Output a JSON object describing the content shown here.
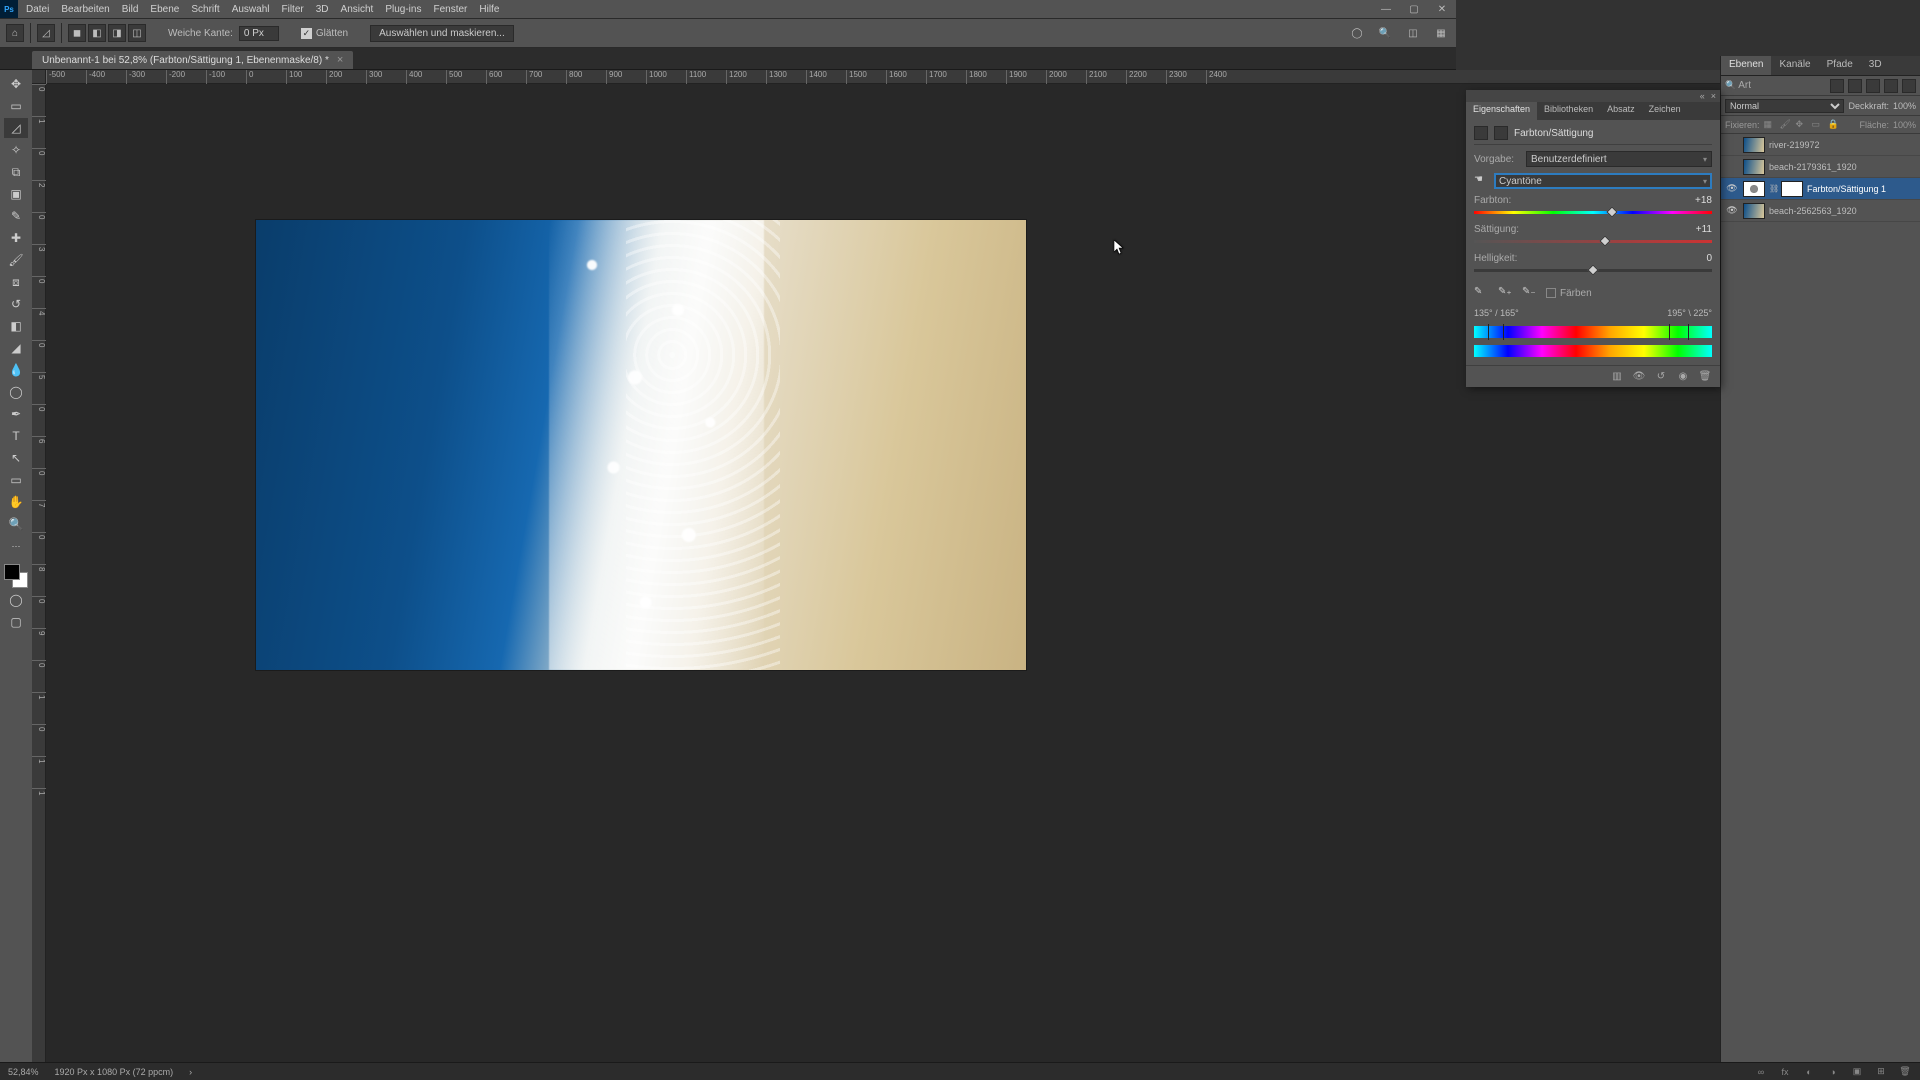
{
  "menu": [
    "Datei",
    "Bearbeiten",
    "Bild",
    "Ebene",
    "Schrift",
    "Auswahl",
    "Filter",
    "3D",
    "Ansicht",
    "Plug-ins",
    "Fenster",
    "Hilfe"
  ],
  "options": {
    "feather_label": "Weiche Kante:",
    "feather_value": "0 Px",
    "antialias_label": "Glätten",
    "select_mask_label": "Auswählen und maskieren..."
  },
  "doc_tab": {
    "title": "Unbenannt-1 bei 52,8% (Farbton/Sättigung 1, Ebenenmaske/8) *"
  },
  "ruler_h": [
    "-500",
    "-400",
    "-300",
    "-200",
    "-100",
    "0",
    "100",
    "200",
    "300",
    "400",
    "500",
    "600",
    "700",
    "800",
    "900",
    "1000",
    "1100",
    "1200",
    "1300",
    "1400",
    "1500",
    "1600",
    "1700",
    "1800",
    "1900",
    "2000",
    "2100",
    "2200",
    "2300",
    "2400"
  ],
  "ruler_v": [
    "0",
    "1",
    "0",
    "2",
    "0",
    "3",
    "0",
    "4",
    "0",
    "5",
    "0",
    "6",
    "0",
    "7",
    "0",
    "8",
    "0",
    "9",
    "0",
    "1",
    "0",
    "1",
    "1"
  ],
  "status": {
    "zoom": "52,84%",
    "dims": "1920 Px x 1080 Px (72 ppcm)"
  },
  "props": {
    "tabs": [
      "Eigenschaften",
      "Bibliotheken",
      "Absatz",
      "Zeichen"
    ],
    "title": "Farbton/Sättigung",
    "preset_label": "Vorgabe:",
    "preset_value": "Benutzerdefiniert",
    "range_value": "Cyantöne",
    "hue_label": "Farbton:",
    "hue_value": "+18",
    "sat_label": "Sättigung:",
    "sat_value": "+11",
    "light_label": "Helligkeit:",
    "light_value": "0",
    "colorize_label": "Färben",
    "range_left": "135° / 165°",
    "range_right": "195° \\ 225°"
  },
  "layers": {
    "tabs": [
      "Ebenen",
      "Kanäle",
      "Pfade",
      "3D"
    ],
    "filter_label": "Art",
    "blend_mode": "Normal",
    "opacity_label": "Deckkraft:",
    "opacity_value": "100%",
    "lock_label": "Fixieren:",
    "fill_label": "Fläche:",
    "fill_value": "100%",
    "rows": [
      {
        "name": "river-219972",
        "visible": false
      },
      {
        "name": "beach-2179361_1920",
        "visible": false
      },
      {
        "name": "Farbton/Sättigung 1",
        "visible": true,
        "adjustment": true,
        "selected": true
      },
      {
        "name": "beach-2562563_1920",
        "visible": true
      }
    ]
  }
}
